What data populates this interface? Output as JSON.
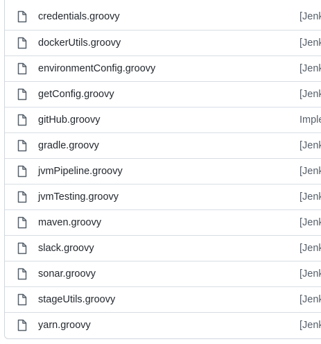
{
  "file_list": {
    "rows": [
      {
        "name": "credentials.groovy",
        "commit": "[Jenk",
        "icon": "file-icon"
      },
      {
        "name": "dockerUtils.groovy",
        "commit": "[Jenk",
        "icon": "file-icon"
      },
      {
        "name": "environmentConfig.groovy",
        "commit": "[Jenk",
        "icon": "file-icon"
      },
      {
        "name": "getConfig.groovy",
        "commit": "[Jenk",
        "icon": "file-icon"
      },
      {
        "name": "gitHub.groovy",
        "commit": "Imple",
        "icon": "file-icon"
      },
      {
        "name": "gradle.groovy",
        "commit": "[Jenk",
        "icon": "file-icon"
      },
      {
        "name": "jvmPipeline.groovy",
        "commit": "[Jenk",
        "icon": "file-icon"
      },
      {
        "name": "jvmTesting.groovy",
        "commit": "[Jenk",
        "icon": "file-icon"
      },
      {
        "name": "maven.groovy",
        "commit": "[Jenk",
        "icon": "file-icon"
      },
      {
        "name": "slack.groovy",
        "commit": "[Jenk",
        "icon": "file-icon"
      },
      {
        "name": "sonar.groovy",
        "commit": "[Jenk",
        "icon": "file-icon"
      },
      {
        "name": "stageUtils.groovy",
        "commit": "[Jenk",
        "icon": "file-icon"
      },
      {
        "name": "yarn.groovy",
        "commit": "[Jenk",
        "icon": "file-icon"
      }
    ]
  },
  "colors": {
    "border": "#d0d7de",
    "row_divider": "#d8dee4",
    "text": "#24292f",
    "muted": "#57606a",
    "icon": "#57606a"
  }
}
